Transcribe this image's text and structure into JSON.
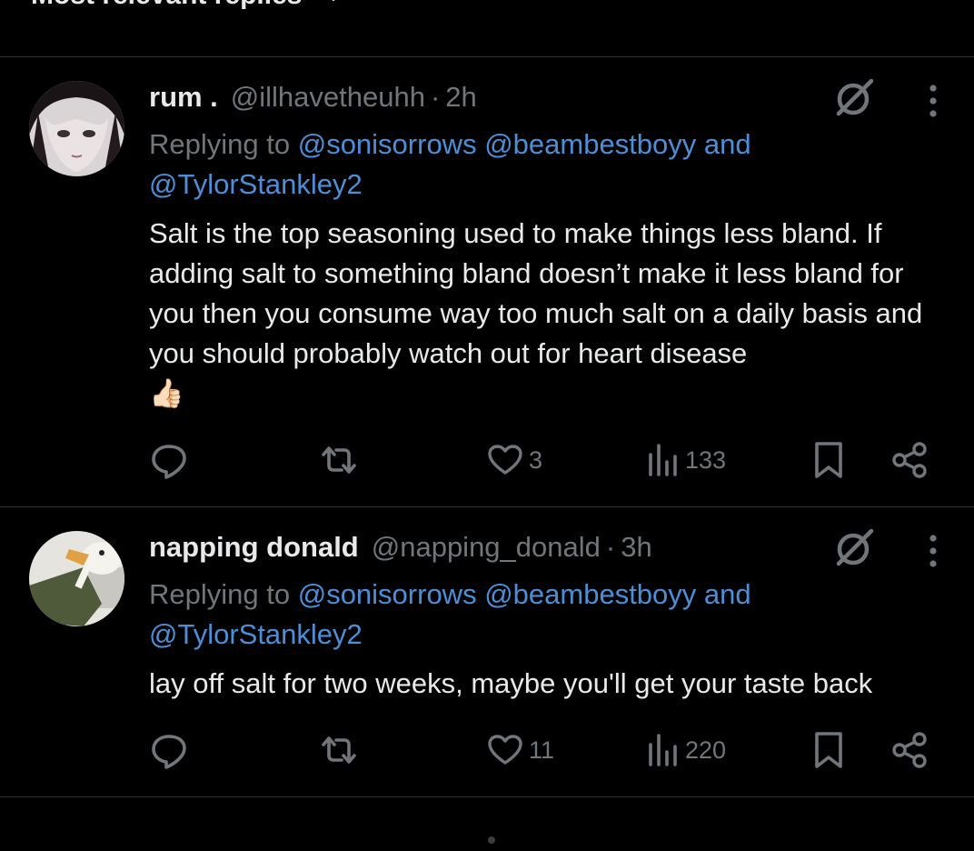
{
  "sort": {
    "label": "Most relevant replies"
  },
  "replies": [
    {
      "display_name": "rum .",
      "handle": "@illhavetheuhh",
      "dot": "·",
      "time": "2h",
      "replying_prefix": "Replying to",
      "mention_1": "@sonisorrows",
      "mention_2": "@beambestboyy",
      "and": "and",
      "mention_3": "@TylorStankley2",
      "text": "Salt is the top seasoning used to make things less bland. If adding salt to something bland doesn’t make it less bland for you then you consume way too much salt on a daily basis and you should probably watch out for heart disease",
      "emoji": "👍🏻",
      "likes": "3",
      "views": "133"
    },
    {
      "display_name": "napping donald",
      "handle": "@napping_donald",
      "dot": "·",
      "time": "3h",
      "replying_prefix": "Replying to",
      "mention_1": "@sonisorrows",
      "mention_2": "@beambestboyy",
      "and": "and",
      "mention_3": "@TylorStankley2",
      "text": "lay off salt for two weeks, maybe you'll get your taste back",
      "likes": "11",
      "views": "220"
    }
  ],
  "colors": {
    "background": "#000000",
    "text": "#e7e9ea",
    "muted": "#71767b",
    "link": "#1d9bf0",
    "divider": "#2f3336"
  }
}
